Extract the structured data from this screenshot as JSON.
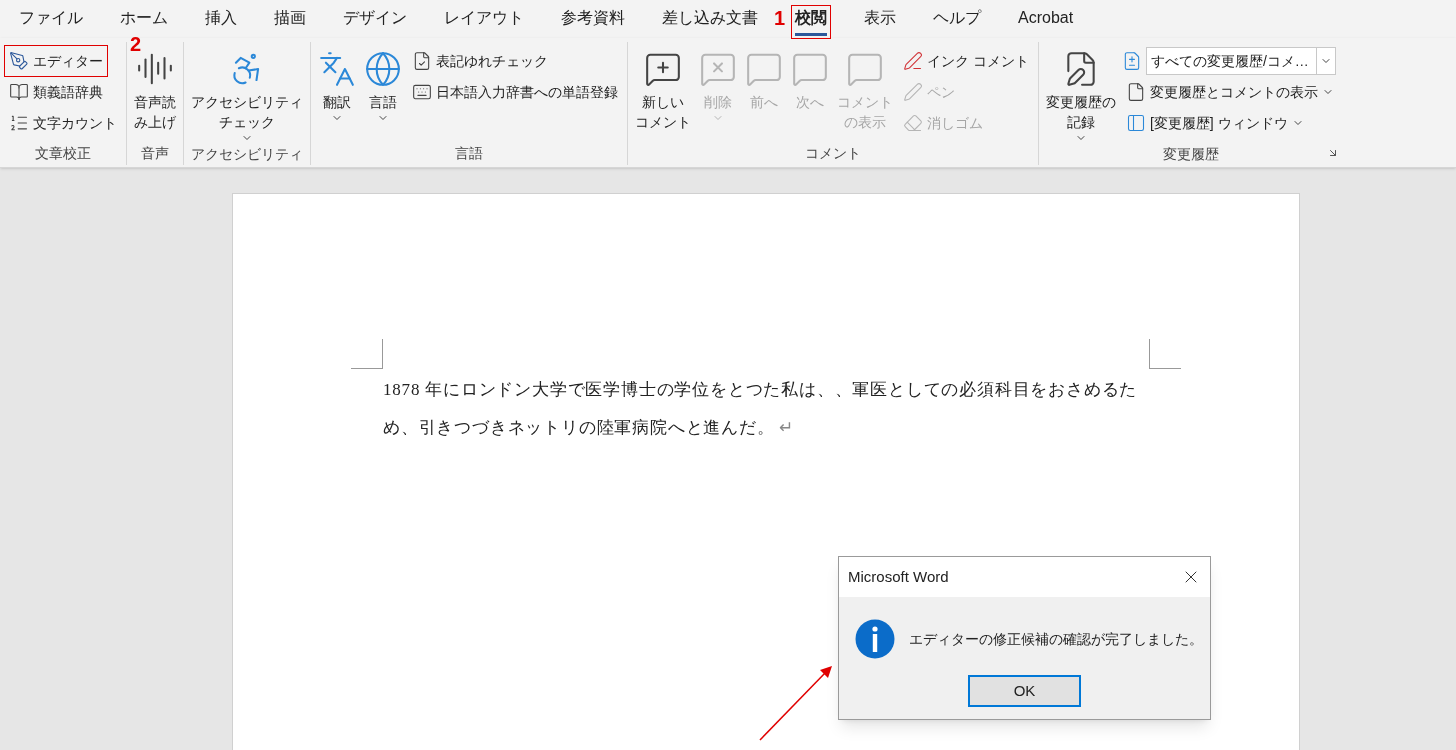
{
  "tabs": [
    {
      "label": "ファイル",
      "selected": false,
      "highlighted": false
    },
    {
      "label": "ホーム",
      "selected": false,
      "highlighted": false
    },
    {
      "label": "挿入",
      "selected": false,
      "highlighted": false
    },
    {
      "label": "描画",
      "selected": false,
      "highlighted": false
    },
    {
      "label": "デザイン",
      "selected": false,
      "highlighted": false
    },
    {
      "label": "レイアウト",
      "selected": false,
      "highlighted": false
    },
    {
      "label": "参考資料",
      "selected": false,
      "highlighted": false
    },
    {
      "label": "差し込み文書",
      "selected": false,
      "highlighted": false
    },
    {
      "label": "校閲",
      "selected": true,
      "highlighted": true,
      "callout": "1"
    },
    {
      "label": "表示",
      "selected": false,
      "highlighted": false
    },
    {
      "label": "ヘルプ",
      "selected": false,
      "highlighted": false
    },
    {
      "label": "Acrobat",
      "selected": false,
      "highlighted": false
    }
  ],
  "ribbon": {
    "groups": [
      {
        "label": "文章校正",
        "items": [
          {
            "kind": "stack",
            "items": [
              {
                "kind": "small",
                "label": "エディター",
                "highlighted": true,
                "callout": "2",
                "disabled": false,
                "dropdown": false
              },
              {
                "kind": "small",
                "label": "類義語辞典",
                "highlighted": false,
                "disabled": false,
                "dropdown": false
              },
              {
                "kind": "small",
                "label": "文字カウント",
                "highlighted": false,
                "disabled": false,
                "dropdown": false
              }
            ]
          }
        ]
      },
      {
        "label": "音声",
        "items": [
          {
            "kind": "large",
            "lines": [
              "音声読",
              "み上げ"
            ],
            "disabled": false,
            "dropdown": false
          }
        ]
      },
      {
        "label": "アクセシビリティ",
        "items": [
          {
            "kind": "large",
            "lines": [
              "アクセシビリティ",
              "チェック"
            ],
            "disabled": false,
            "dropdown": true
          }
        ]
      },
      {
        "label": "言語",
        "items": [
          {
            "kind": "large",
            "lines": [
              "翻訳"
            ],
            "disabled": false,
            "dropdown": true
          },
          {
            "kind": "large",
            "lines": [
              "言語"
            ],
            "disabled": false,
            "dropdown": true
          },
          {
            "kind": "stack",
            "items": [
              {
                "kind": "small",
                "label": "表記ゆれチェック",
                "disabled": false,
                "dropdown": false
              },
              {
                "kind": "small",
                "label": "日本語入力辞書への単語登録",
                "disabled": false,
                "dropdown": false
              }
            ]
          }
        ]
      },
      {
        "label": "コメント",
        "items": [
          {
            "kind": "large",
            "lines": [
              "新しい",
              "コメント"
            ],
            "disabled": false,
            "dropdown": false
          },
          {
            "kind": "large",
            "lines": [
              "削除"
            ],
            "disabled": true,
            "dropdown": true
          },
          {
            "kind": "large",
            "lines": [
              "前へ"
            ],
            "disabled": true,
            "dropdown": false
          },
          {
            "kind": "large",
            "lines": [
              "次へ"
            ],
            "disabled": true,
            "dropdown": false
          },
          {
            "kind": "large",
            "lines": [
              "コメント",
              "の表示"
            ],
            "disabled": true,
            "dropdown": false
          },
          {
            "kind": "stack",
            "items": [
              {
                "kind": "small",
                "label": "インク コメント",
                "disabled": false,
                "dropdown": false
              },
              {
                "kind": "small",
                "label": "ペン",
                "disabled": true,
                "dropdown": false
              },
              {
                "kind": "small",
                "label": "消しゴム",
                "disabled": true,
                "dropdown": false
              }
            ]
          }
        ]
      },
      {
        "label": "変更履歴",
        "launcher": true,
        "items": [
          {
            "kind": "large",
            "lines": [
              "変更履歴の",
              "記録"
            ],
            "disabled": false,
            "dropdown": true
          },
          {
            "kind": "stack",
            "items": [
              {
                "kind": "select",
                "value": "すべての変更履歴/コメ…",
                "disabled": false,
                "dropdown": true
              },
              {
                "kind": "small",
                "label": "変更履歴とコメントの表示",
                "disabled": false,
                "dropdown": true
              },
              {
                "kind": "small",
                "label": "[変更履歴] ウィンドウ",
                "disabled": false,
                "dropdown": true
              }
            ]
          }
        ]
      }
    ]
  },
  "document": {
    "paragraph": "1878 年にロンドン大学で医学博士の学位をとつた私は、、軍医としての必須科目をおさめるため、引きつづきネットリの陸軍病院へと進んだ。",
    "paragraph_mark": "↵"
  },
  "dialog": {
    "title": "Microsoft Word",
    "message": "エディターの修正候補の確認が完了しました。",
    "button": "OK"
  }
}
